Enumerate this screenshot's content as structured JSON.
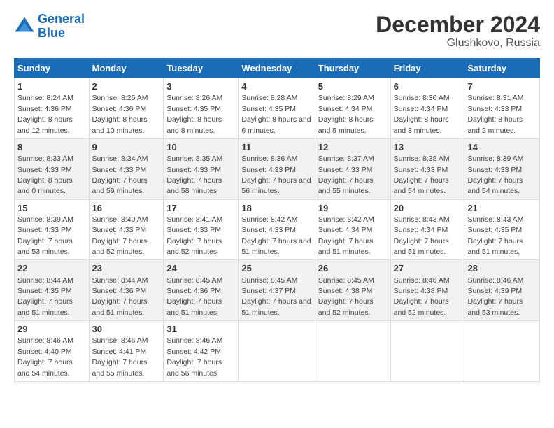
{
  "logo": {
    "line1": "General",
    "line2": "Blue"
  },
  "title": "December 2024",
  "subtitle": "Glushkovo, Russia",
  "days_of_week": [
    "Sunday",
    "Monday",
    "Tuesday",
    "Wednesday",
    "Thursday",
    "Friday",
    "Saturday"
  ],
  "weeks": [
    [
      {
        "day": "1",
        "sunrise": "8:24 AM",
        "sunset": "4:36 PM",
        "daylight": "8 hours and 12 minutes."
      },
      {
        "day": "2",
        "sunrise": "8:25 AM",
        "sunset": "4:36 PM",
        "daylight": "8 hours and 10 minutes."
      },
      {
        "day": "3",
        "sunrise": "8:26 AM",
        "sunset": "4:35 PM",
        "daylight": "8 hours and 8 minutes."
      },
      {
        "day": "4",
        "sunrise": "8:28 AM",
        "sunset": "4:35 PM",
        "daylight": "8 hours and 6 minutes."
      },
      {
        "day": "5",
        "sunrise": "8:29 AM",
        "sunset": "4:34 PM",
        "daylight": "8 hours and 5 minutes."
      },
      {
        "day": "6",
        "sunrise": "8:30 AM",
        "sunset": "4:34 PM",
        "daylight": "8 hours and 3 minutes."
      },
      {
        "day": "7",
        "sunrise": "8:31 AM",
        "sunset": "4:33 PM",
        "daylight": "8 hours and 2 minutes."
      }
    ],
    [
      {
        "day": "8",
        "sunrise": "8:33 AM",
        "sunset": "4:33 PM",
        "daylight": "8 hours and 0 minutes."
      },
      {
        "day": "9",
        "sunrise": "8:34 AM",
        "sunset": "4:33 PM",
        "daylight": "7 hours and 59 minutes."
      },
      {
        "day": "10",
        "sunrise": "8:35 AM",
        "sunset": "4:33 PM",
        "daylight": "7 hours and 58 minutes."
      },
      {
        "day": "11",
        "sunrise": "8:36 AM",
        "sunset": "4:33 PM",
        "daylight": "7 hours and 56 minutes."
      },
      {
        "day": "12",
        "sunrise": "8:37 AM",
        "sunset": "4:33 PM",
        "daylight": "7 hours and 55 minutes."
      },
      {
        "day": "13",
        "sunrise": "8:38 AM",
        "sunset": "4:33 PM",
        "daylight": "7 hours and 54 minutes."
      },
      {
        "day": "14",
        "sunrise": "8:39 AM",
        "sunset": "4:33 PM",
        "daylight": "7 hours and 54 minutes."
      }
    ],
    [
      {
        "day": "15",
        "sunrise": "8:39 AM",
        "sunset": "4:33 PM",
        "daylight": "7 hours and 53 minutes."
      },
      {
        "day": "16",
        "sunrise": "8:40 AM",
        "sunset": "4:33 PM",
        "daylight": "7 hours and 52 minutes."
      },
      {
        "day": "17",
        "sunrise": "8:41 AM",
        "sunset": "4:33 PM",
        "daylight": "7 hours and 52 minutes."
      },
      {
        "day": "18",
        "sunrise": "8:42 AM",
        "sunset": "4:33 PM",
        "daylight": "7 hours and 51 minutes."
      },
      {
        "day": "19",
        "sunrise": "8:42 AM",
        "sunset": "4:34 PM",
        "daylight": "7 hours and 51 minutes."
      },
      {
        "day": "20",
        "sunrise": "8:43 AM",
        "sunset": "4:34 PM",
        "daylight": "7 hours and 51 minutes."
      },
      {
        "day": "21",
        "sunrise": "8:43 AM",
        "sunset": "4:35 PM",
        "daylight": "7 hours and 51 minutes."
      }
    ],
    [
      {
        "day": "22",
        "sunrise": "8:44 AM",
        "sunset": "4:35 PM",
        "daylight": "7 hours and 51 minutes."
      },
      {
        "day": "23",
        "sunrise": "8:44 AM",
        "sunset": "4:36 PM",
        "daylight": "7 hours and 51 minutes."
      },
      {
        "day": "24",
        "sunrise": "8:45 AM",
        "sunset": "4:36 PM",
        "daylight": "7 hours and 51 minutes."
      },
      {
        "day": "25",
        "sunrise": "8:45 AM",
        "sunset": "4:37 PM",
        "daylight": "7 hours and 51 minutes."
      },
      {
        "day": "26",
        "sunrise": "8:45 AM",
        "sunset": "4:38 PM",
        "daylight": "7 hours and 52 minutes."
      },
      {
        "day": "27",
        "sunrise": "8:46 AM",
        "sunset": "4:38 PM",
        "daylight": "7 hours and 52 minutes."
      },
      {
        "day": "28",
        "sunrise": "8:46 AM",
        "sunset": "4:39 PM",
        "daylight": "7 hours and 53 minutes."
      }
    ],
    [
      {
        "day": "29",
        "sunrise": "8:46 AM",
        "sunset": "4:40 PM",
        "daylight": "7 hours and 54 minutes."
      },
      {
        "day": "30",
        "sunrise": "8:46 AM",
        "sunset": "4:41 PM",
        "daylight": "7 hours and 55 minutes."
      },
      {
        "day": "31",
        "sunrise": "8:46 AM",
        "sunset": "4:42 PM",
        "daylight": "7 hours and 56 minutes."
      },
      null,
      null,
      null,
      null
    ]
  ]
}
